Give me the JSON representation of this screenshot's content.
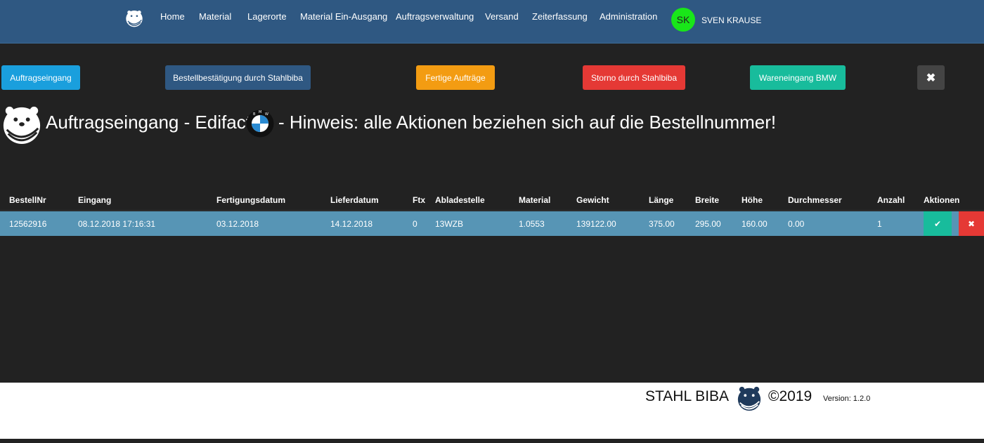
{
  "nav": {
    "logo_icon": "beaver-logo-icon",
    "items": [
      {
        "label": "Home"
      },
      {
        "label": "Material"
      },
      {
        "label": "Lagerorte"
      },
      {
        "label": "Material Ein-Ausgang"
      },
      {
        "label": "Auftragsverwaltung"
      },
      {
        "label": "Versand"
      },
      {
        "label": "Zeiterfassung"
      },
      {
        "label": "Administration"
      }
    ],
    "user": {
      "initials": "SK",
      "name": "SVEN KRAUSE",
      "avatar_color": "#19e619"
    }
  },
  "actions": {
    "auftragseingang": "Auftragseingang",
    "bestellbestaetigung": "Bestellbestätigung durch Stahlbiba",
    "fertige_auftraege": "Fertige Aufträge",
    "storno": "Storno durch Stahlbiba",
    "wareneingang": "Wareneingang BMW",
    "close": "✖"
  },
  "heading": {
    "part1": "Auftragseingang - Edifact",
    "part2": "- Hinweis: alle Aktionen beziehen sich auf die Bestellnummer!",
    "bmw_letters": [
      "B",
      "M",
      "W"
    ]
  },
  "table": {
    "columns": [
      "BestellNr",
      "Eingang",
      "Fertigungsdatum",
      "Lieferdatum",
      "Ftx",
      "Abladestelle",
      "Material",
      "Gewicht",
      "Länge",
      "Breite",
      "Höhe",
      "Durchmesser",
      "Anzahl",
      "Aktionen"
    ],
    "rows": [
      [
        "12562916",
        "08.12.2018 17:16:31",
        "03.12.2018",
        "14.12.2018",
        "0",
        "13WZB",
        "1.0553",
        "139122.00",
        "375.00",
        "295.00",
        "160.00",
        "0.00",
        "1"
      ]
    ],
    "row_actions": {
      "confirm": "✔",
      "delete": "✖"
    }
  },
  "footer": {
    "brand": "STAHL BIBA",
    "copyright": "©2019",
    "version": "Version: 1.2.0"
  },
  "colors": {
    "navbar": "#2f5882",
    "background": "#222222",
    "row_highlight": "#5795b5",
    "info": "#1a9fdd",
    "warning": "#f39c12",
    "danger": "#e53935",
    "success": "#18bc9c"
  }
}
